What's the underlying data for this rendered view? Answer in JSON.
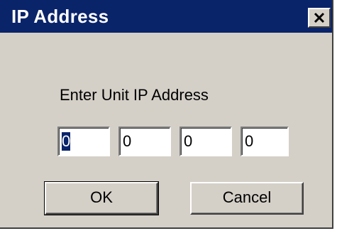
{
  "window": {
    "title": "IP Address",
    "close_icon": "close-icon"
  },
  "prompt": "Enter Unit IP Address",
  "ip_fields": {
    "octet1": "0",
    "octet2": "0",
    "octet3": "0",
    "octet4": "0"
  },
  "buttons": {
    "ok_label": "OK",
    "cancel_label": "Cancel"
  },
  "colors": {
    "titlebar": "#0a246a",
    "dialog_face": "#d4d0c8",
    "selection": "#0a246a"
  }
}
